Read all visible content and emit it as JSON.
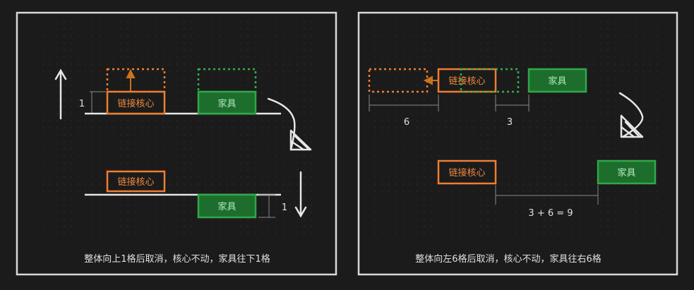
{
  "panels": [
    {
      "core_label": "链接核心",
      "furniture_label": "家具",
      "up_offset_label": "1",
      "down_offset_label": "1",
      "caption": "整体向上1格后取消，核心不动，家具往下1格"
    },
    {
      "core_label": "链接核心",
      "furniture_label": "家具",
      "shift_left_label": "6",
      "shift_right_label": "3",
      "sum_label": "3 + 6 = 9",
      "caption": "整体向左6格后取消，核心不动，家具往右6格"
    }
  ],
  "colors": {
    "background": "#1b1b1b",
    "frame": "#d9d9d9",
    "core_stroke": "#f07d32",
    "core_text": "#f08a3c",
    "furniture_fill": "#1d6e2c",
    "furniture_stroke": "#2fa84a",
    "furniture_text": "#b5e8c0",
    "ghost_furniture": "#33b04e",
    "arrow_up": "#c9721f",
    "line": "#e6e6e6",
    "dim": "#8a8a8a",
    "text": "#e0e0e0"
  }
}
